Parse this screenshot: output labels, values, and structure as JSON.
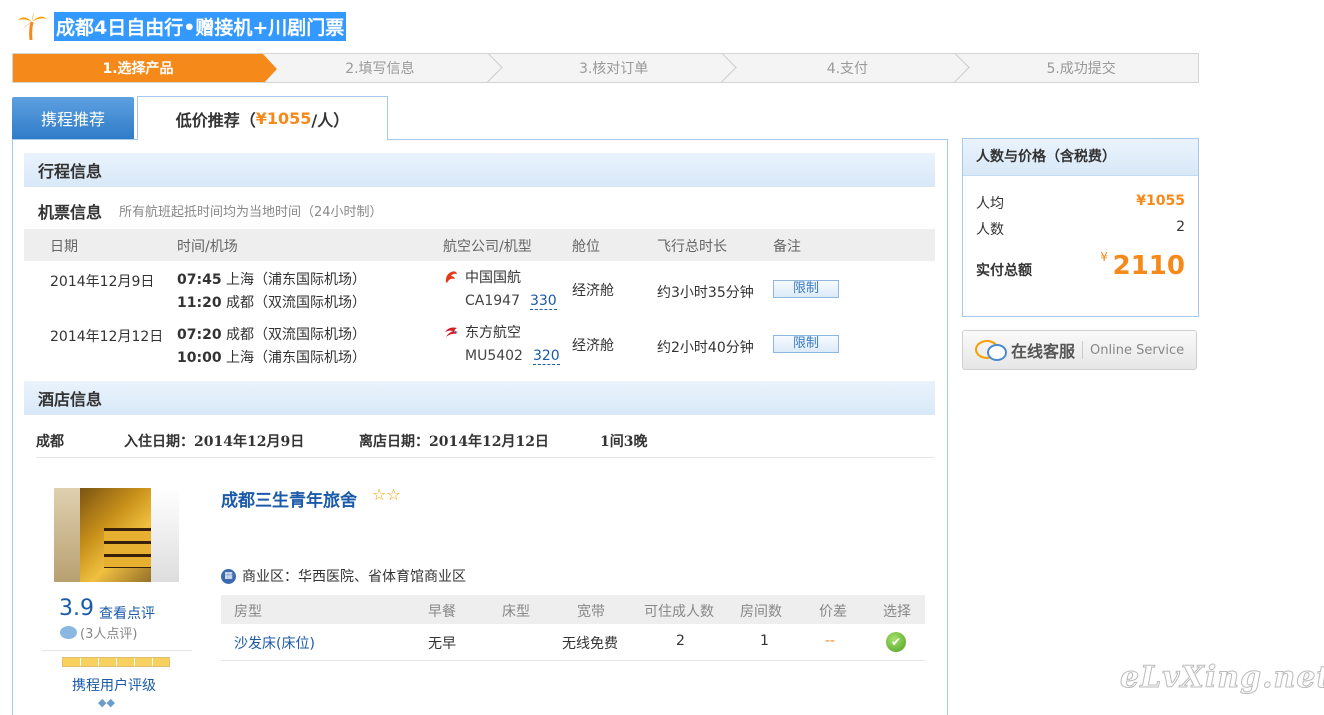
{
  "page": {
    "title": "成都4日自由行•赠接机+川剧门票"
  },
  "steps": [
    {
      "label": "1.选择产品"
    },
    {
      "label": "2.填写信息"
    },
    {
      "label": "3.核对订单"
    },
    {
      "label": "4.支付"
    },
    {
      "label": "5.成功提交"
    }
  ],
  "tabs": {
    "tab1": "携程推荐",
    "tab2_prefix": "低价推荐（",
    "tab2_price": "¥1055",
    "tab2_suffix": "/人）"
  },
  "itinerary": {
    "heading": "行程信息",
    "flights_title": "机票信息",
    "flights_note": "所有航班起抵时间均为当地时间（24小时制）",
    "columns": [
      "日期",
      "时间/机场",
      "航空公司/机型",
      "舱位",
      "飞行总时长",
      "备注"
    ],
    "flights": [
      {
        "date": "2014年12月9日",
        "dep_time": "07:45",
        "dep_airport": " 上海（浦东国际机场）",
        "arr_time": "11:20",
        "arr_airport": " 成都（双流国际机场）",
        "airline": "中国国航",
        "airline_icon": "air-china-icon",
        "flight_no": "CA1947",
        "plane": "330",
        "cabin": "经济舱",
        "duration": "约3小时35分钟",
        "remark": "限制"
      },
      {
        "date": "2014年12月12日",
        "dep_time": "07:20",
        "dep_airport": " 成都（双流国际机场）",
        "arr_time": "10:00",
        "arr_airport": " 上海（浦东国际机场）",
        "airline": "东方航空",
        "airline_icon": "china-eastern-icon",
        "flight_no": "MU5402",
        "plane": "320",
        "cabin": "经济舱",
        "duration": "约2小时40分钟",
        "remark": "限制"
      }
    ]
  },
  "hotel": {
    "heading": "酒店信息",
    "city": "成都",
    "checkin": "入住日期：2014年12月9日",
    "checkout": "离店日期：2014年12月12日",
    "nights": "1间3晚",
    "name": "成都三生青年旅舍",
    "stars": "☆☆",
    "score": "3.9",
    "review_link": "查看点评",
    "review_count": "(3人点评)",
    "user_level_label": "携程用户评级",
    "diamonds": "◆◆",
    "district": "商业区：华西医院、省体育馆商业区",
    "room_columns": [
      "房型",
      "早餐",
      "床型",
      "宽带",
      "可住成人数",
      "房间数",
      "价差",
      "选择"
    ],
    "rooms": [
      {
        "type": "沙发床(床位)",
        "breakfast": "无早",
        "bed": "",
        "broadband": "无线免费",
        "adults": "2",
        "rooms": "1",
        "price_diff": "--",
        "select_icon": "check-circle-icon"
      }
    ]
  },
  "price_panel": {
    "heading": "人数与价格（含税费）",
    "per_person_label": "人均",
    "per_person_value": "¥1055",
    "count_label": "人数",
    "count_value": "2",
    "total_label": "实付总额",
    "total_currency": "¥",
    "total_value": "2110"
  },
  "service": {
    "cn": "在线客服",
    "en": "Online Service"
  },
  "watermark": "eLvXing.net",
  "colors": {
    "accent": "#f5891a",
    "link": "#1a5aa8",
    "border": "#a9c9ea",
    "title_highlight": "#3399ff"
  }
}
